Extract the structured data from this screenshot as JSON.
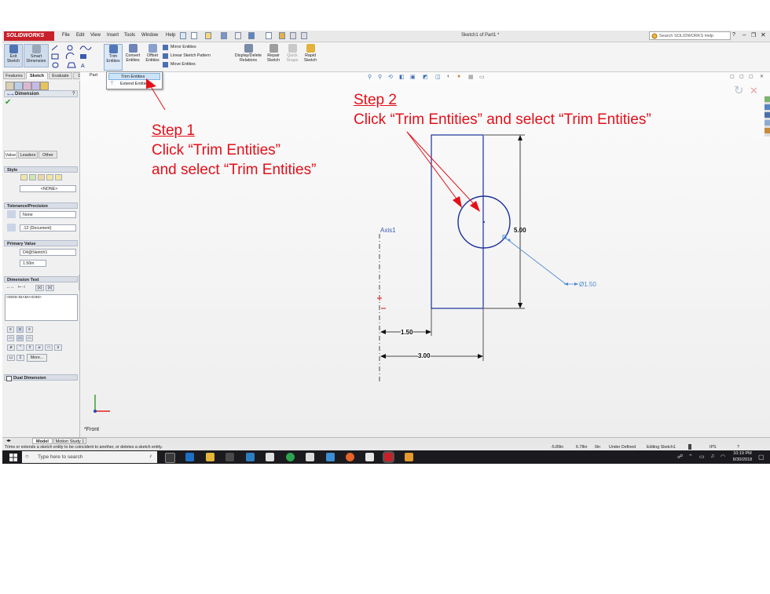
{
  "app": {
    "brand": "SOLIDWORKS",
    "document_title": "Sketch1 of Part1 *",
    "search_placeholder": "Search SOLIDWORKS Help",
    "menus": [
      "File",
      "Edit",
      "View",
      "Insert",
      "Tools",
      "Window",
      "Help"
    ]
  },
  "command_manager": {
    "exit_sketch": [
      "Exit",
      "Sketch"
    ],
    "smart_dimension": [
      "Smart",
      "Dimension"
    ],
    "trim_entities": [
      "Trim",
      "Entities"
    ],
    "convert_entities": [
      "Convert",
      "Entities"
    ],
    "offset_entities": [
      "Offset",
      "Entities"
    ],
    "mirror_entities": "Mirror Entities",
    "linear_sketch_pattern": "Linear Sketch Pattern",
    "move_entities": "Move Entities",
    "display_delete_relations": [
      "Display/Delete",
      "Relations"
    ],
    "repair_sketch": [
      "Repair",
      "Sketch"
    ],
    "quick_snaps": [
      "Quick",
      "Snaps"
    ],
    "rapid_sketch": [
      "Rapid",
      "Sketch"
    ]
  },
  "tabs": [
    "Features",
    "Sketch",
    "Evaluate",
    "DimXpert"
  ],
  "dropdown": {
    "items": [
      "Trim Entities",
      "Extend Entities"
    ]
  },
  "tree_label": "Part",
  "property_manager": {
    "title": "Dimension",
    "tabs": [
      "Value",
      "Leaders",
      "Other"
    ],
    "style_section": "Style",
    "style_value": "<NONE>",
    "tolerance_section": "Tolerance/Precision",
    "tolerance_value": "None",
    "precision_value": ".12 (Document)",
    "primary_section": "Primary Value",
    "primary_name": "D4@Sketch1",
    "primary_value": "1.50in",
    "dimtext_section": "Dimension Text",
    "dimtext_value": "<MOD-DIAM><DIM>",
    "more_button": "More...",
    "dual_section": "Dual Dimension"
  },
  "sketch": {
    "axis_label": "Axis1",
    "dim_height": "5.00",
    "dim_offset": "1.50",
    "dim_width": "3.00",
    "dim_diameter": "Ø1.50",
    "view_label": "*Front"
  },
  "annotations": {
    "step1_title": "Step 1",
    "step1_line1": "Click “Trim Entities”",
    "step1_line2": "and select “Trim Entities”",
    "step2_title": "Step 2",
    "step2_line1": "Click “Trim Entities” and select “Trim Entities”"
  },
  "model_tabs": [
    "Model",
    "Motion Study 1"
  ],
  "status": {
    "message": "Trims or extends a sketch entity to be coincident to another, or deletes a sketch entity.",
    "x": "-5.89in",
    "y": "6.78in",
    "z": "0in",
    "definition": "Under Defined",
    "editing": "Editing Sketch1",
    "units": "IPS"
  },
  "taskbar": {
    "search_placeholder": "Type here to search",
    "time": "10:19 PM",
    "date": "8/30/2018"
  },
  "colors": {
    "annotation_red": "#e3101a",
    "sketch_blue": "#1a2f9c",
    "dimension_black": "#111111",
    "taskbar": "#1b1b1f"
  }
}
